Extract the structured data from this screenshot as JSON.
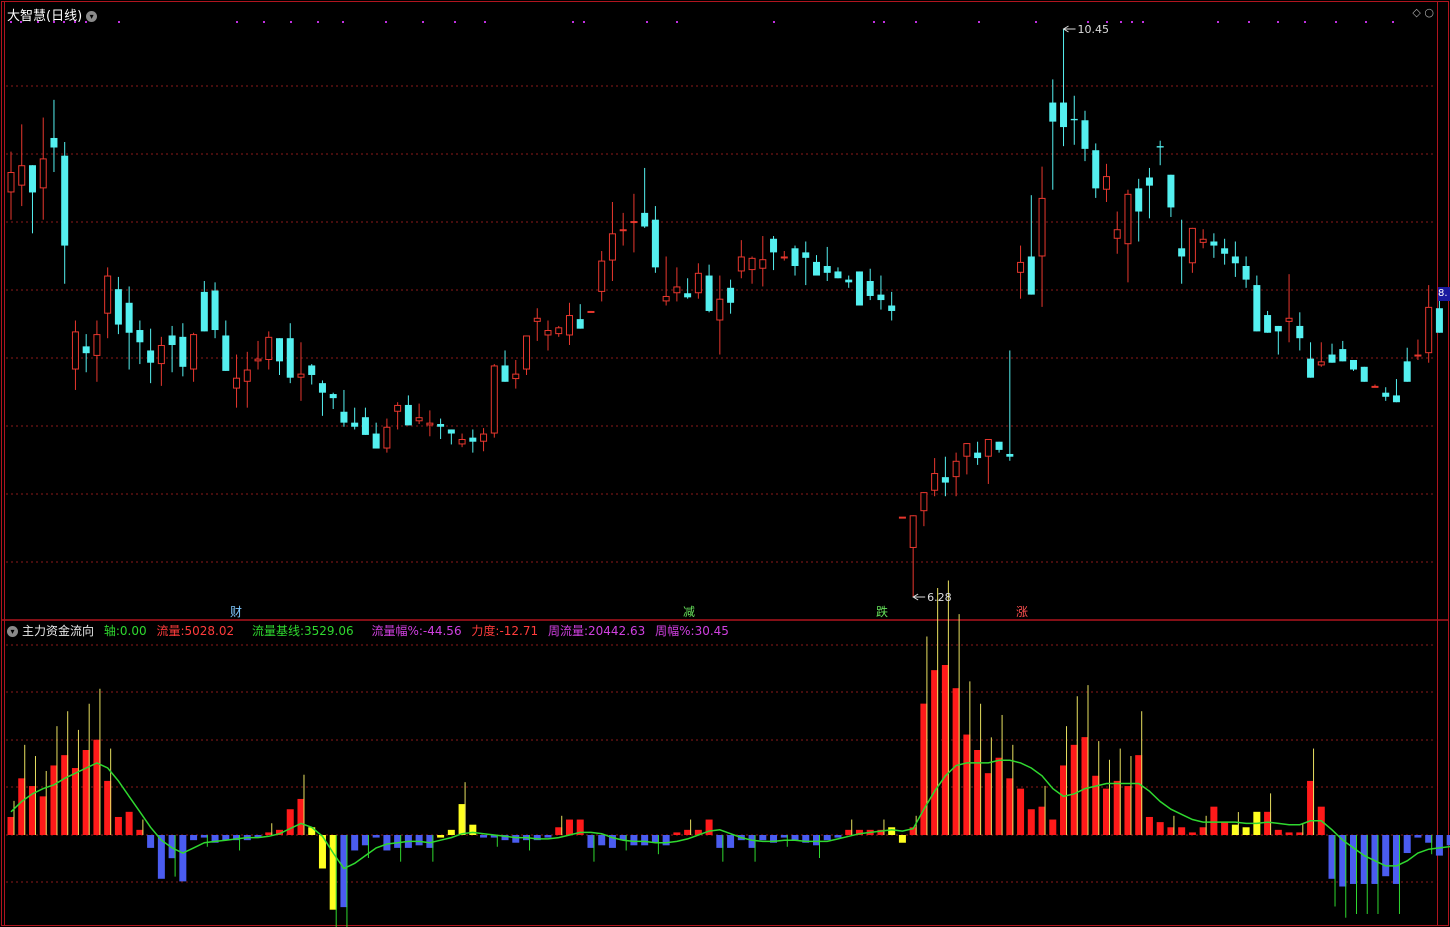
{
  "main_panel": {
    "title": "大智慧(日线)",
    "high_label": "10.45",
    "low_label": "6.28",
    "right_price_tag": "8.",
    "signals": [
      {
        "text": "财",
        "color": "#7fc8ff"
      },
      {
        "text": "减",
        "color": "#66e05a"
      },
      {
        "text": "跌",
        "color": "#66e05a"
      },
      {
        "text": "涨",
        "color": "#ff5050"
      }
    ]
  },
  "indicator_panel": {
    "title": "主力资金流向",
    "axis_label": "轴:",
    "axis_value": "0.00",
    "flow_label": "流量:",
    "flow_value": "5028.02",
    "baseline_label": "流量基线:",
    "baseline_value": "3529.06",
    "flow_pct_label": "流量幅%:",
    "flow_pct_value": "-44.56",
    "force_label": "力度:",
    "force_value": "-12.71",
    "week_flow_label": "周流量:",
    "week_flow_value": "20442.63",
    "week_pct_label": "周幅%:",
    "week_pct_value": "30.45"
  },
  "colors": {
    "background": "#000000",
    "border": "#b0141e",
    "grid": "#8b1a1a",
    "up_candle": "#e8372e",
    "down_candle": "#54f0f0",
    "bar_red": "#ff1a1a",
    "bar_blue": "#4a5cf0",
    "bar_yellow": "#ffff20",
    "baseline_line": "#2fd82f",
    "thin_lines": "#e8e060",
    "dots": "#c030e0"
  },
  "chart_data": [
    {
      "type": "candlestick",
      "title": "大智慧(日线)",
      "ylim": [
        6.28,
        10.45
      ],
      "annotations": [
        {
          "text": "10.45",
          "type": "max"
        },
        {
          "text": "6.28",
          "type": "min"
        }
      ],
      "candles": [
        [
          9.25,
          9.55,
          9.05,
          9.4
        ],
        [
          9.3,
          9.75,
          9.15,
          9.45
        ],
        [
          9.45,
          9.35,
          8.95,
          9.25
        ],
        [
          9.28,
          9.8,
          9.05,
          9.5
        ],
        [
          9.65,
          9.93,
          9.4,
          9.58
        ],
        [
          9.52,
          9.62,
          8.58,
          8.86
        ],
        [
          7.95,
          8.31,
          7.8,
          8.23
        ],
        [
          8.12,
          8.21,
          7.93,
          8.07
        ],
        [
          8.05,
          8.31,
          7.86,
          8.21
        ],
        [
          8.36,
          8.7,
          8.18,
          8.64
        ],
        [
          8.54,
          8.63,
          8.21,
          8.28
        ],
        [
          8.44,
          8.56,
          7.95,
          8.22
        ],
        [
          8.24,
          8.31,
          7.99,
          8.15
        ],
        [
          8.09,
          8.25,
          7.85,
          8.0
        ],
        [
          7.99,
          8.19,
          7.83,
          8.13
        ],
        [
          8.2,
          8.27,
          7.93,
          8.13
        ],
        [
          8.19,
          8.29,
          7.9,
          7.97
        ],
        [
          7.95,
          8.22,
          7.86,
          8.21
        ],
        [
          8.52,
          8.6,
          8.24,
          8.23
        ],
        [
          8.53,
          8.59,
          8.18,
          8.24
        ],
        [
          8.2,
          8.31,
          8.05,
          7.94
        ],
        [
          7.81,
          8.06,
          7.67,
          7.89
        ],
        [
          7.86,
          8.08,
          7.67,
          7.95
        ],
        [
          8.01,
          8.16,
          7.95,
          8.03
        ],
        [
          8.02,
          8.23,
          7.95,
          8.19
        ],
        [
          8.18,
          8.18,
          7.91,
          8.01
        ],
        [
          8.18,
          8.29,
          7.85,
          7.89
        ],
        [
          7.89,
          8.15,
          7.72,
          7.92
        ],
        [
          7.98,
          7.99,
          7.84,
          7.91
        ],
        [
          7.85,
          7.87,
          7.61,
          7.78
        ],
        [
          7.77,
          7.78,
          7.66,
          7.74
        ],
        [
          7.64,
          7.8,
          7.53,
          7.56
        ],
        [
          7.56,
          7.67,
          7.51,
          7.53
        ],
        [
          7.6,
          7.67,
          7.51,
          7.47
        ],
        [
          7.48,
          7.56,
          7.39,
          7.37
        ],
        [
          7.37,
          7.59,
          7.34,
          7.53
        ],
        [
          7.64,
          7.71,
          7.51,
          7.69
        ],
        [
          7.69,
          7.76,
          7.54,
          7.54
        ],
        [
          7.57,
          7.7,
          7.55,
          7.6
        ],
        [
          7.54,
          7.65,
          7.46,
          7.56
        ],
        [
          7.55,
          7.59,
          7.44,
          7.53
        ],
        [
          7.51,
          7.51,
          7.4,
          7.48
        ],
        [
          7.4,
          7.48,
          7.38,
          7.44
        ],
        [
          7.45,
          7.51,
          7.34,
          7.42
        ],
        [
          7.42,
          7.52,
          7.35,
          7.48
        ],
        [
          7.48,
          7.99,
          7.45,
          7.98
        ],
        [
          7.98,
          8.09,
          7.9,
          7.86
        ],
        [
          7.88,
          8.02,
          7.81,
          7.92
        ],
        [
          7.95,
          8.19,
          7.91,
          8.2
        ],
        [
          8.3,
          8.4,
          8.16,
          8.33
        ],
        [
          8.2,
          8.31,
          8.09,
          8.24
        ],
        [
          8.21,
          8.27,
          8.19,
          8.26
        ],
        [
          8.2,
          8.44,
          8.13,
          8.35
        ],
        [
          8.32,
          8.43,
          8.25,
          8.25
        ],
        [
          8.38,
          8.38,
          8.37,
          8.38
        ],
        [
          8.52,
          8.82,
          8.45,
          8.75
        ],
        [
          8.75,
          9.18,
          8.6,
          8.95
        ],
        [
          8.98,
          9.1,
          8.86,
          8.98
        ],
        [
          9.04,
          9.24,
          8.81,
          9.04
        ],
        [
          9.1,
          9.43,
          8.99,
          9.0
        ],
        [
          9.05,
          9.15,
          8.66,
          8.7
        ],
        [
          8.45,
          8.78,
          8.42,
          8.49
        ],
        [
          8.51,
          8.7,
          8.45,
          8.56
        ],
        [
          8.51,
          8.62,
          8.47,
          8.48
        ],
        [
          8.51,
          8.73,
          8.47,
          8.66
        ],
        [
          8.64,
          8.72,
          8.37,
          8.38
        ],
        [
          8.31,
          8.64,
          8.06,
          8.47
        ],
        [
          8.55,
          8.61,
          8.36,
          8.44
        ],
        [
          8.67,
          8.9,
          8.62,
          8.78
        ],
        [
          8.68,
          8.78,
          8.58,
          8.77
        ],
        [
          8.69,
          8.93,
          8.56,
          8.76
        ],
        [
          8.91,
          8.93,
          8.68,
          8.81
        ],
        [
          8.77,
          8.82,
          8.75,
          8.78
        ],
        [
          8.84,
          8.86,
          8.64,
          8.71
        ],
        [
          8.81,
          8.89,
          8.57,
          8.77
        ],
        [
          8.74,
          8.79,
          8.64,
          8.64
        ],
        [
          8.71,
          8.85,
          8.6,
          8.66
        ],
        [
          8.67,
          8.7,
          8.64,
          8.62
        ],
        [
          8.61,
          8.64,
          8.55,
          8.59
        ],
        [
          8.67,
          8.6,
          8.46,
          8.42
        ],
        [
          8.6,
          8.69,
          8.46,
          8.49
        ],
        [
          8.5,
          8.64,
          8.39,
          8.46
        ],
        [
          8.42,
          8.52,
          8.31,
          8.38
        ],
        [
          6.87,
          6.87,
          6.87,
          6.87
        ],
        [
          6.64,
          6.88,
          6.28,
          6.88
        ],
        [
          6.91,
          6.97,
          6.8,
          7.05
        ],
        [
          7.06,
          7.3,
          7.02,
          7.19
        ],
        [
          7.16,
          7.31,
          7.02,
          7.12
        ],
        [
          7.16,
          7.34,
          7.02,
          7.28
        ],
        [
          7.31,
          7.38,
          7.18,
          7.41
        ],
        [
          7.34,
          7.42,
          7.25,
          7.3
        ],
        [
          7.31,
          7.37,
          7.11,
          7.44
        ],
        [
          7.42,
          7.42,
          7.34,
          7.36
        ],
        [
          7.33,
          8.09,
          7.28,
          7.31
        ],
        [
          8.66,
          8.86,
          8.47,
          8.74
        ],
        [
          8.78,
          9.23,
          8.54,
          8.5
        ],
        [
          8.78,
          9.44,
          8.41,
          9.21
        ],
        [
          9.91,
          10.08,
          9.27,
          9.77
        ],
        [
          9.91,
          10.45,
          9.59,
          9.73
        ],
        [
          9.79,
          9.96,
          9.6,
          9.78
        ],
        [
          9.78,
          9.85,
          9.48,
          9.57
        ],
        [
          9.56,
          9.61,
          9.21,
          9.28
        ],
        [
          9.27,
          9.46,
          9.18,
          9.37
        ],
        [
          8.91,
          9.11,
          8.8,
          8.98
        ],
        [
          8.87,
          9.27,
          8.59,
          9.24
        ],
        [
          9.28,
          9.35,
          8.89,
          9.11
        ],
        [
          9.36,
          9.43,
          9.06,
          9.3
        ],
        [
          9.59,
          9.63,
          9.45,
          9.58
        ],
        [
          9.38,
          9.37,
          9.07,
          9.14
        ],
        [
          8.84,
          9.05,
          8.58,
          8.78
        ],
        [
          8.73,
          8.99,
          8.66,
          8.99
        ],
        [
          8.88,
          8.98,
          8.84,
          8.91
        ],
        [
          8.89,
          8.95,
          8.77,
          8.86
        ],
        [
          8.84,
          8.91,
          8.72,
          8.8
        ],
        [
          8.78,
          8.89,
          8.63,
          8.73
        ],
        [
          8.71,
          8.78,
          8.55,
          8.61
        ],
        [
          8.57,
          8.64,
          8.27,
          8.23
        ],
        [
          8.35,
          8.38,
          8.25,
          8.22
        ],
        [
          8.27,
          8.17,
          8.06,
          8.23
        ],
        [
          8.3,
          8.65,
          8.15,
          8.33
        ],
        [
          8.27,
          8.37,
          8.09,
          8.18
        ],
        [
          8.03,
          8.15,
          7.96,
          7.89
        ],
        [
          7.98,
          8.15,
          7.97,
          8.01
        ],
        [
          8.06,
          8.14,
          8.03,
          8.0
        ],
        [
          8.1,
          8.16,
          8.07,
          8.01
        ],
        [
          8.02,
          8.01,
          7.94,
          7.95
        ],
        [
          7.97,
          7.97,
          7.87,
          7.86
        ],
        [
          7.82,
          7.84,
          7.82,
          7.83
        ],
        [
          7.78,
          7.82,
          7.72,
          7.75
        ],
        [
          7.76,
          7.88,
          7.8,
          7.71
        ],
        [
          8.01,
          8.11,
          7.87,
          7.86
        ],
        [
          8.06,
          8.17,
          8.02,
          8.06
        ],
        [
          8.07,
          8.57,
          8.0,
          8.41
        ],
        [
          8.4,
          8.47,
          8.32,
          8.22
        ]
      ]
    },
    {
      "type": "bar",
      "title": "主力资金流向",
      "series": [
        {
          "name": "流量",
          "values": [
            700,
            2200,
            1900,
            1500,
            2700,
            3100,
            2600,
            3300,
            3700,
            2100,
            700,
            900,
            200,
            -500,
            -1700,
            -900,
            -1800,
            -200,
            -100,
            -300,
            -200,
            -200,
            -200,
            -100,
            100,
            200,
            1000,
            1400,
            300,
            -1300,
            -2900,
            -2800,
            -600,
            -400,
            -100,
            -600,
            -500,
            -500,
            -400,
            -500,
            -100,
            200,
            1200,
            400,
            -100,
            -100,
            -200,
            -300,
            -200,
            -200,
            -100,
            300,
            600,
            600,
            -500,
            -400,
            -500,
            -200,
            -400,
            -400,
            -300,
            -400,
            100,
            200,
            200,
            600,
            -500,
            -500,
            -200,
            -500,
            -200,
            -300,
            -100,
            -200,
            -300,
            -400,
            -200,
            -100,
            200,
            200,
            200,
            200,
            300,
            -300,
            300,
            5100,
            6400,
            6600,
            5700,
            3900,
            3300,
            2400,
            3000,
            2200,
            1800,
            1000,
            1100,
            600,
            2700,
            3500,
            3800,
            2300,
            1800,
            2100,
            1900,
            3100,
            700,
            500,
            300,
            300,
            100,
            300,
            1100,
            500,
            400,
            300,
            900,
            900,
            200,
            100,
            100,
            2100,
            1100,
            -1700,
            -2000,
            -1900,
            -1900,
            -1900,
            -1600,
            -1900,
            -700,
            -100,
            -300,
            -800,
            -400,
            -300,
            -600,
            -500,
            -200,
            -400,
            -400,
            -600,
            -900,
            -500,
            -200,
            -400,
            -300,
            -300,
            -300,
            -300,
            -100,
            1400,
            1600,
            1400,
            1400,
            3500
          ]
        },
        {
          "name": "流量基线",
          "values": [
            900,
            1300,
            1600,
            1800,
            1950,
            2200,
            2400,
            2600,
            2800,
            2600,
            2100,
            1500,
            900,
            300,
            -200,
            -500,
            -700,
            -500,
            -300,
            -250,
            -200,
            -150,
            -100,
            -100,
            -50,
            50,
            250,
            450,
            300,
            -50,
            -700,
            -1300,
            -1100,
            -800,
            -500,
            -350,
            -300,
            -250,
            -250,
            -300,
            -200,
            -100,
            50,
            100,
            50,
            0,
            -50,
            -100,
            -100,
            -150,
            -150,
            -100,
            0,
            100,
            100,
            50,
            -100,
            -200,
            -250,
            -250,
            -300,
            -300,
            -250,
            -150,
            0,
            150,
            200,
            50,
            -100,
            -200,
            -250,
            -250,
            -200,
            -200,
            -250,
            -250,
            -250,
            -150,
            -50,
            50,
            100,
            150,
            200,
            150,
            250,
            1000,
            1700,
            2300,
            2700,
            2800,
            2800,
            2800,
            2900,
            2900,
            2800,
            2600,
            2300,
            1800,
            1500,
            1600,
            1800,
            1900,
            2000,
            2000,
            2000,
            2000,
            1700,
            1300,
            1000,
            800,
            600,
            500,
            500,
            500,
            500,
            450,
            450,
            500,
            450,
            400,
            400,
            550,
            550,
            200,
            -200,
            -500,
            -800,
            -1000,
            -1200,
            -1200,
            -1000,
            -700,
            -550,
            -500,
            -450,
            -400,
            -400,
            -400,
            -350,
            -350,
            -350,
            -400,
            -450,
            -450,
            -400,
            -400,
            -350,
            -300,
            -300,
            -300,
            -250,
            50,
            300,
            550,
            800,
            1300
          ]
        }
      ]
    }
  ]
}
